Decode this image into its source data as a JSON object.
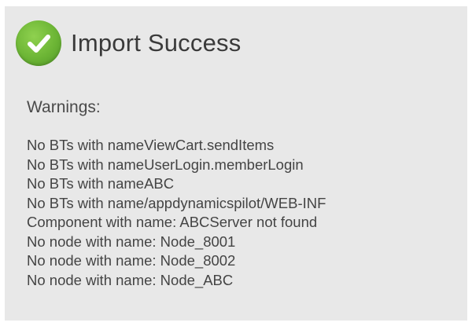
{
  "dialog": {
    "icon": "check-circle-icon",
    "title": "Import Success",
    "warnings_label": "Warnings:",
    "warnings": [
      "No BTs with nameViewCart.sendItems",
      "No BTs with nameUserLogin.memberLogin",
      "No BTs with nameABC",
      "No BTs with name/appdynamicspilot/WEB-INF",
      "Component with name: ABCServer not found",
      "No node with name: Node_8001",
      "No node with name: Node_8002",
      "No node with name: Node_ABC"
    ]
  },
  "colors": {
    "panel_background": "#e8e8e8",
    "success_green": "#6cb535",
    "text": "#444444"
  }
}
